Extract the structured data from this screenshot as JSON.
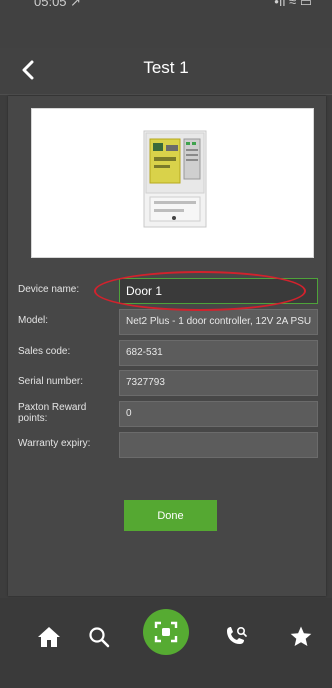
{
  "status_bar": {
    "time": "05:05 ↗",
    "right": "•ıl  ≈  ▭"
  },
  "nav": {
    "title": "Test 1",
    "back_icon": "chevron-left-icon"
  },
  "device_form": {
    "device_name": {
      "label": "Device name:",
      "value": "Door 1"
    },
    "model": {
      "label": "Model:",
      "value": "Net2 Plus - 1 door controller, 12V 2A PSU"
    },
    "sales_code": {
      "label": "Sales code:",
      "value": "682-531"
    },
    "serial_number": {
      "label": "Serial number:",
      "value": "7327793"
    },
    "reward_points": {
      "label": "Paxton Reward points:",
      "value": "0"
    },
    "warranty_expiry": {
      "label": "Warranty expiry:",
      "value": ""
    }
  },
  "done_label": "Done",
  "tab_bar": {
    "items": [
      "home-icon",
      "search-icon",
      "scan-icon",
      "phone-search-icon",
      "star-icon"
    ]
  },
  "colors": {
    "accent": "#55a832",
    "highlight": "#d2222d",
    "background": "#3d3d3d"
  }
}
